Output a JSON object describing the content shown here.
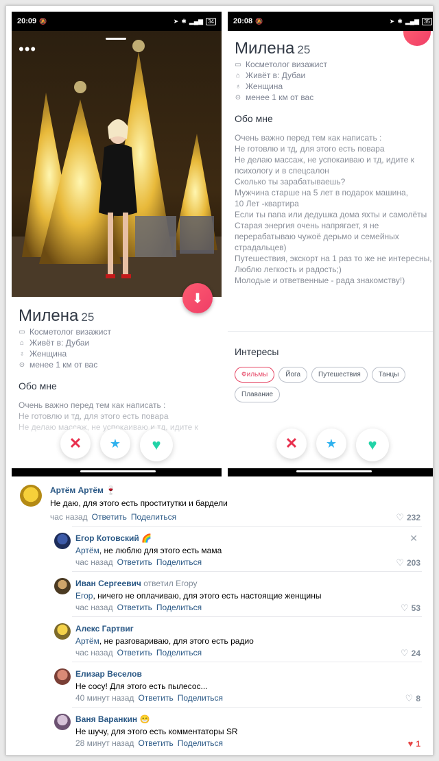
{
  "left_phone": {
    "time": "20:09",
    "battery": "34",
    "name": "Милена",
    "age": "25",
    "job": "Косметолог визажист",
    "lives": "Живёт в: Дубаи",
    "gender": "Женщина",
    "distance": "менее 1 км от вас",
    "about_title": "Обо мне",
    "about_text": "Очень важно перед тем как написать :\nНе готовлю и тд, для этого есть повара\nНе делаю массаж, не успокаиваю и тд, идите к"
  },
  "right_phone": {
    "time": "20:08",
    "battery": "35",
    "name": "Милена",
    "age": "25",
    "job": "Косметолог визажист",
    "lives": "Живёт в: Дубаи",
    "gender": "Женщина",
    "distance": "менее 1 км от вас",
    "about_title": "Обо мне",
    "about_text": "Очень важно перед тем как написать :\nНе готовлю и тд, для этого есть повара\nНе делаю массаж, не успокаиваю и тд, идите к психологу и в спецсалон\n  Сколько ты зарабатываешь?\nМужчина старше на 5 лет в подарок машина,\n 10 Лет -квартира\nЕсли ты папа или дедушка дома яхты и самолёты\nСтарая энергия очень напрягает, я не перерабатываю чужоё дерьмо и семейных страдальцев)\n Путешествия, экскорт на 1 раз то же не интересны,\nЛюблю легкость и радость;)\nМолодые и ответвенные - рада знакомству!)",
    "interests_title": "Интересы",
    "interests": [
      "Фильмы",
      "Йога",
      "Путешествия",
      "Танцы",
      "Плавание"
    ]
  },
  "icons": {
    "job": "briefcase-icon",
    "home": "home-icon",
    "gender": "person-icon",
    "location": "location-pin-icon",
    "nope": "close-icon",
    "superlike": "star-icon",
    "like": "heart-icon"
  },
  "colors": {
    "accent": "#fd5b70",
    "link": "#2a5885",
    "meta": "#818c99",
    "like_active": "#e64646"
  },
  "comments": [
    {
      "author": "Артём Артём",
      "emoji": "🍷",
      "text": "Не даю, для этого есть проститутки и бардели",
      "time": "час назад",
      "reply": "Ответить",
      "share": "Поделиться",
      "likes": "232"
    },
    {
      "author": "Егор Котовский",
      "emoji": "🌈",
      "mention": "Артём",
      "text": ", не люблю для этого есть мама",
      "time": "час назад",
      "reply": "Ответить",
      "share": "Поделиться",
      "likes": "203"
    },
    {
      "author": "Иван Сергеевич",
      "replied": "ответил Егору",
      "mention": "Егор",
      "text": ", ничего не оплачиваю, для этого есть настоящие женщины",
      "time": "час назад",
      "reply": "Ответить",
      "share": "Поделиться",
      "likes": "53"
    },
    {
      "author": "Алекс Гартвиг",
      "mention": "Артём",
      "text": ", не разговариваю, для этого есть радио",
      "time": "час назад",
      "reply": "Ответить",
      "share": "Поделиться",
      "likes": "24"
    },
    {
      "author": "Елизар Веселов",
      "text": "Не сосу! Для этого есть пылесос...",
      "time": "40 минут назад",
      "reply": "Ответить",
      "share": "Поделиться",
      "likes": "8"
    },
    {
      "author": "Ваня Варанкин",
      "emoji": "😁",
      "text": "Не шучу, для этого есть комментаторы SR",
      "time": "28 минут назад",
      "reply": "Ответить",
      "share": "Поделиться",
      "likes": "1",
      "liked": true
    }
  ]
}
